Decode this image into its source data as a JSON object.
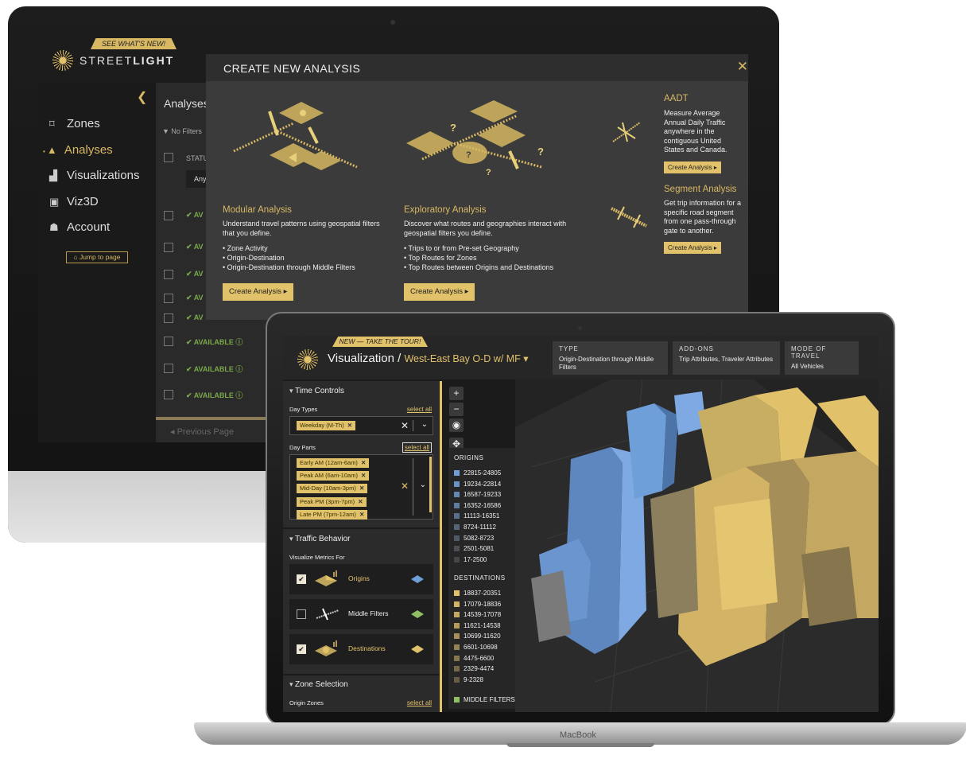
{
  "imac": {
    "brand_light": "STREET",
    "brand_bold": "LIGHT",
    "ribbon": "SEE WHAT'S NEW!",
    "nav": [
      {
        "label": "Zones",
        "icon": "zones-icon"
      },
      {
        "label": "Analyses",
        "icon": "analyses-icon",
        "active": true
      },
      {
        "label": "Visualizations",
        "icon": "chart-icon"
      },
      {
        "label": "Viz3D",
        "icon": "viz3d-icon"
      },
      {
        "label": "Account",
        "icon": "account-icon"
      }
    ],
    "jump_to_page": "Jump to page",
    "analyses_title": "Analyses",
    "no_filters": "No Filters",
    "status_col": "STATU",
    "any_label": "Any",
    "available_partial": "AV",
    "available": "AVAILABLE",
    "previous_page": "Previous Page",
    "modal": {
      "title": "CREATE NEW ANALYSIS",
      "modular": {
        "heading": "Modular Analysis",
        "desc": "Understand travel patterns using geospatial filters that you define.",
        "items": [
          "Zone Activity",
          "Origin-Destination",
          "Origin-Destination through Middle Filters"
        ],
        "button": "Create Analysis"
      },
      "exploratory": {
        "heading": "Exploratory Analysis",
        "desc": "Discover what routes and geographies interact with geospatial filters you define.",
        "items": [
          "Trips to or from Pre-set Geography",
          "Top Routes for Zones",
          "Top Routes between Origins and Destinations"
        ],
        "button": "Create Analysis"
      },
      "aadt": {
        "heading": "AADT",
        "desc": "Measure Average Annual Daily Traffic anywhere in the contiguous United States and Canada.",
        "button": "Create Analysis"
      },
      "segment": {
        "heading": "Segment Analysis",
        "desc": "Get trip information for a specific road segment from one pass-through gate to another.",
        "button": "Create Analysis"
      }
    }
  },
  "macbook": {
    "label": "MacBook",
    "ribbon": "NEW — TAKE THE TOUR!",
    "title": "Visualization",
    "separator": "/",
    "analysis_name": "West-East Bay O-D w/ MF",
    "meta": [
      {
        "key": "TYPE",
        "value": "Origin-Destination through Middle Filters"
      },
      {
        "key": "ADD-ONS",
        "value": "Trip Attributes, Traveler Attributes"
      },
      {
        "key": "MODE OF TRAVEL",
        "value": "All Vehicles"
      }
    ],
    "time_controls": "Time Controls",
    "day_types_label": "Day Types",
    "select_all": "select all",
    "day_types": [
      "Weekday (M-Th)"
    ],
    "day_parts_label": "Day Parts",
    "day_parts": [
      "Early AM (12am-6am)",
      "Peak AM (6am-10am)",
      "Mid-Day (10am-3pm)",
      "Peak PM (3pm-7pm)",
      "Late PM (7pm-12am)"
    ],
    "traffic_behavior": "Traffic Behavior",
    "visualize_for": "Visualize Metrics For",
    "metrics": [
      {
        "label": "Origins",
        "checked": true,
        "color": "#6f9fd8"
      },
      {
        "label": "Middle Filters",
        "checked": false,
        "color": "#8fbf63"
      },
      {
        "label": "Destinations",
        "checked": true,
        "color": "#e2c16b"
      }
    ],
    "zone_selection": "Zone Selection",
    "origin_zones": "Origin Zones",
    "legend": {
      "origins_title": "ORIGINS",
      "origins": [
        {
          "range": "22815-24805",
          "color": "#6f9fd8"
        },
        {
          "range": "19234-22814",
          "color": "#6a93c6"
        },
        {
          "range": "16587-19233",
          "color": "#6587b3"
        },
        {
          "range": "16352-16586",
          "color": "#5f7ba0"
        },
        {
          "range": "11113-16351",
          "color": "#5a6f8c"
        },
        {
          "range": "8724-11112",
          "color": "#556479"
        },
        {
          "range": "5082-8723",
          "color": "#505966"
        },
        {
          "range": "2501-5081",
          "color": "#4b4f54"
        },
        {
          "range": "17-2500",
          "color": "#464646"
        }
      ],
      "destinations_title": "DESTINATIONS",
      "destinations": [
        {
          "range": "18837-20351",
          "color": "#e2c16b"
        },
        {
          "range": "17079-18836",
          "color": "#d3b466"
        },
        {
          "range": "14539-17078",
          "color": "#c4a861"
        },
        {
          "range": "11621-14538",
          "color": "#b49b5c"
        },
        {
          "range": "10699-11620",
          "color": "#a58e57"
        },
        {
          "range": "6601-10698",
          "color": "#958252"
        },
        {
          "range": "4475-6600",
          "color": "#86754d"
        },
        {
          "range": "2329-4474",
          "color": "#776948"
        },
        {
          "range": "9-2328",
          "color": "#675c43"
        }
      ],
      "middle_filters": "MIDDLE FILTERS",
      "middle_color": "#8fbf63"
    }
  }
}
